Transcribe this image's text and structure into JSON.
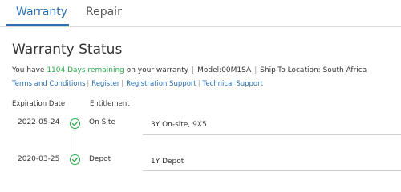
{
  "tabs": [
    {
      "label": "Warranty",
      "active": true
    },
    {
      "label": "Repair",
      "active": false
    }
  ],
  "page_title": "Warranty Status",
  "status": {
    "prefix": "You have ",
    "days_remaining": "1104 Days remaining",
    "suffix": " on your warranty",
    "model": "Model:00M1SA",
    "ship_to": "Ship-To Location: South Africa"
  },
  "links": [
    {
      "label": "Terms and Conditions"
    },
    {
      "label": "Register"
    },
    {
      "label": "Registration Support"
    },
    {
      "label": "Technical Support"
    }
  ],
  "columns": {
    "expiration": "Expiration Date",
    "entitlement": "Entitlement"
  },
  "rows": [
    {
      "date": "2022-05-24",
      "entitlement": "On Site",
      "description": "3Y On-site, 9X5"
    },
    {
      "date": "2020-03-25",
      "entitlement": "Depot",
      "description": "1Y Depot"
    }
  ],
  "colors": {
    "accent": "#2b6fb0",
    "success": "#2aa84a"
  },
  "icons": {
    "status": "check-circle-icon"
  }
}
